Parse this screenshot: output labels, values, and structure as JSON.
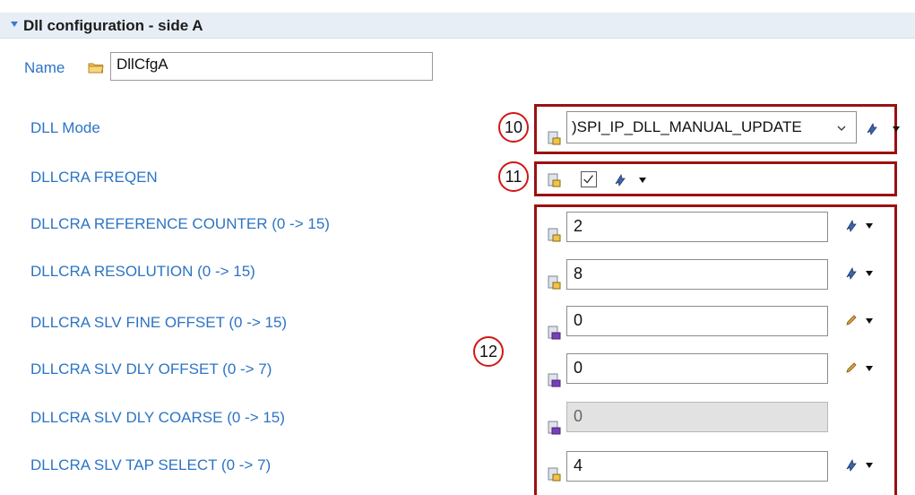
{
  "section": {
    "title": "Dll configuration - side A"
  },
  "name_row": {
    "label": "Name",
    "value": "DllCfgA"
  },
  "callouts": {
    "c10": "10",
    "c11": "11",
    "c12": "12"
  },
  "fields": {
    "dll_mode": {
      "label": "DLL Mode",
      "value": ")SPI_IP_DLL_MANUAL_UPDATE"
    },
    "freqen": {
      "label": "DLLCRA FREQEN",
      "checked": true
    },
    "ref_counter": {
      "label": "DLLCRA REFERENCE COUNTER (0 -> 15)",
      "value": "2"
    },
    "resolution": {
      "label": "DLLCRA RESOLUTION (0 -> 15)",
      "value": "8"
    },
    "slv_fine_offset": {
      "label": "DLLCRA SLV FINE OFFSET (0 -> 15)",
      "value": "0"
    },
    "slv_dly_offset": {
      "label": "DLLCRA SLV DLY OFFSET (0 -> 7)",
      "value": "0"
    },
    "slv_dly_coarse": {
      "label": "DLLCRA SLV DLY COARSE (0 -> 15)",
      "value": "0"
    },
    "slv_tap_select": {
      "label": "DLLCRA SLV TAP SELECT (0 -> 7)",
      "value": "4"
    }
  },
  "colors": {
    "label_blue": "#2c74c4",
    "callout_border": "#9b1111",
    "callout_circle": "#d01818"
  }
}
